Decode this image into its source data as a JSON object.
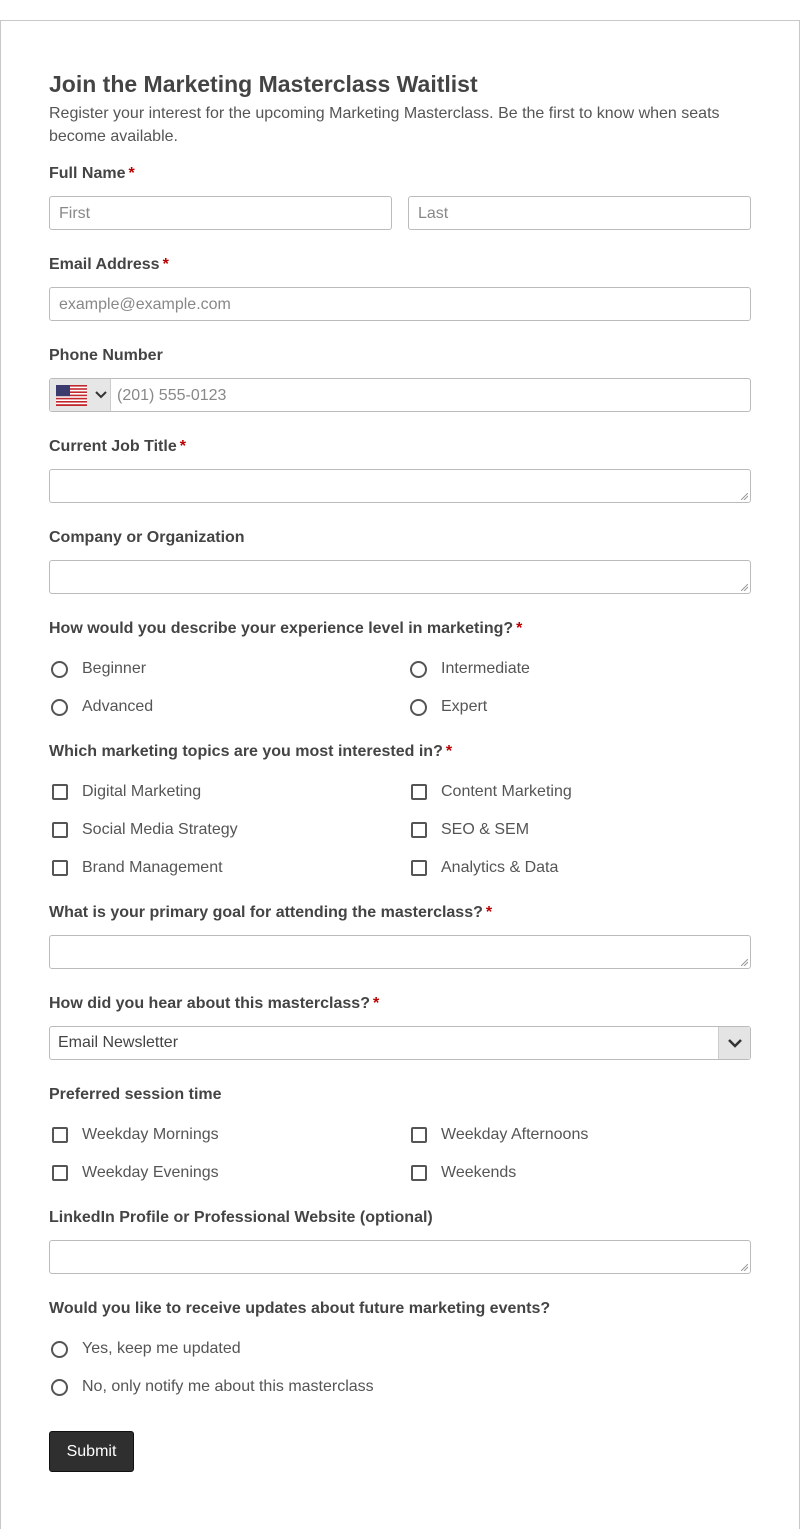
{
  "form": {
    "title": "Join the Marketing Masterclass Waitlist",
    "description": "Register your interest for the upcoming Marketing Masterclass. Be the first to know when seats become available.",
    "required_mark": "*"
  },
  "full_name": {
    "label": "Full Name",
    "first_placeholder": "First",
    "last_placeholder": "Last"
  },
  "email": {
    "label": "Email Address",
    "placeholder": "example@example.com"
  },
  "phone": {
    "label": "Phone Number",
    "placeholder": "(201) 555-0123",
    "country_flag_icon": "us-flag-icon"
  },
  "job_title": {
    "label": "Current Job Title"
  },
  "company": {
    "label": "Company or Organization"
  },
  "experience": {
    "label": "How would you describe your experience level in marketing?",
    "options": [
      "Beginner",
      "Intermediate",
      "Advanced",
      "Expert"
    ]
  },
  "topics": {
    "label": "Which marketing topics are you most interested in?",
    "options": [
      "Digital Marketing",
      "Content Marketing",
      "Social Media Strategy",
      "SEO & SEM",
      "Brand Management",
      "Analytics & Data"
    ]
  },
  "goal": {
    "label": "What is your primary goal for attending the masterclass?"
  },
  "source": {
    "label": "How did you hear about this masterclass?",
    "selected": "Email Newsletter"
  },
  "session": {
    "label": "Preferred session time",
    "options": [
      "Weekday Mornings",
      "Weekday Afternoons",
      "Weekday Evenings",
      "Weekends"
    ]
  },
  "linkedin": {
    "label": "LinkedIn Profile or Professional Website (optional)"
  },
  "updates": {
    "label": "Would you like to receive updates about future marketing events?",
    "options": [
      "Yes, keep me updated",
      "No, only notify me about this masterclass"
    ]
  },
  "submit_label": "Submit",
  "colors": {
    "required": "#bb0000",
    "button_bg": "#2f2f2f",
    "border": "#bbbbbb"
  }
}
